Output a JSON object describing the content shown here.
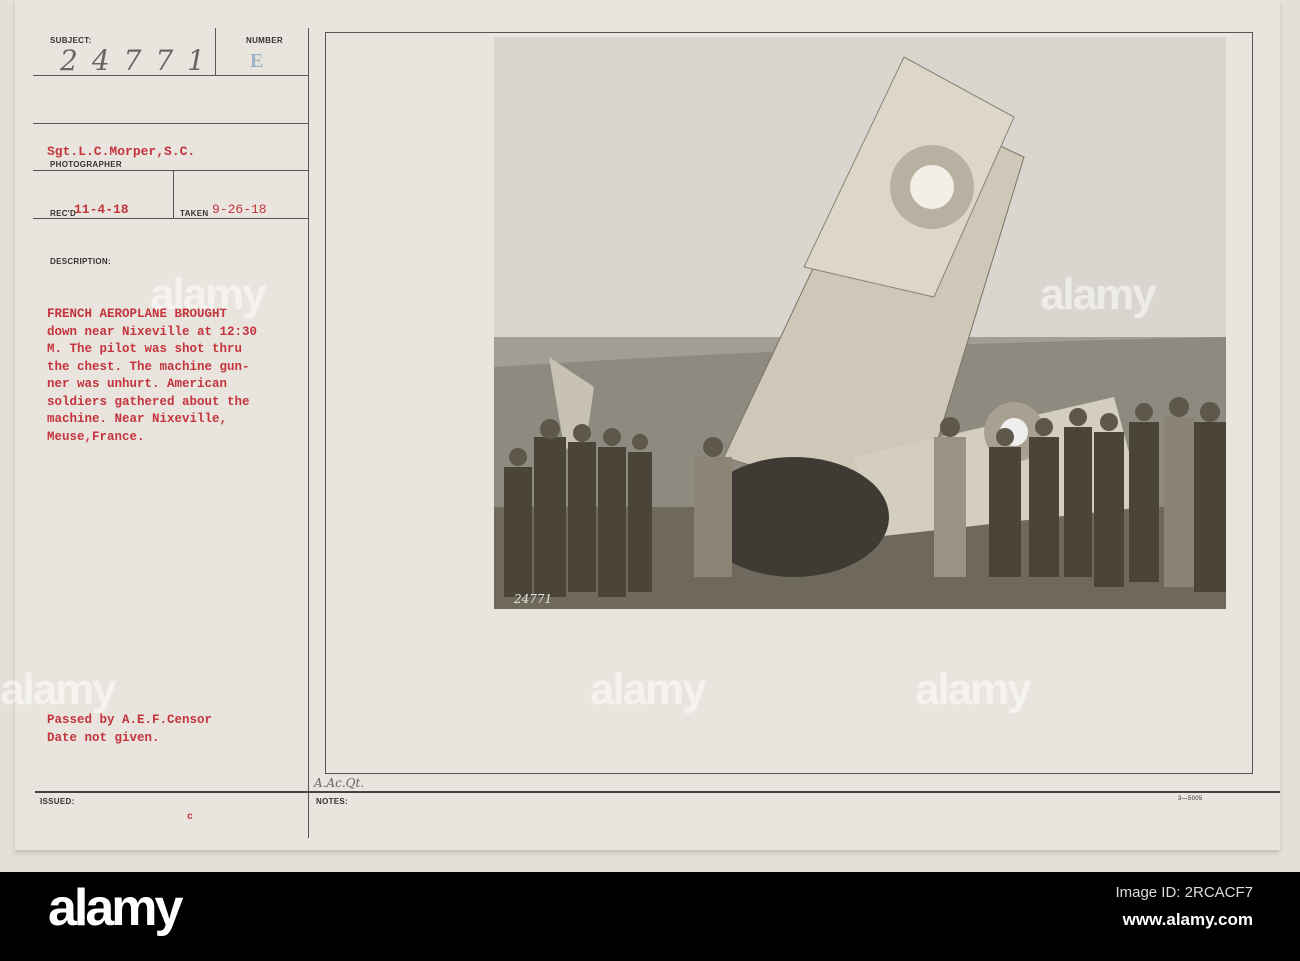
{
  "card": {
    "subject_label": "SUBJECT:",
    "subject_value": "24771",
    "number_label": "NUMBER",
    "number_value": "E",
    "photographer": "Sgt.L.C.Morper,S.C.",
    "photographer_label": "PHOTOGRAPHER",
    "recd_label": "REC'D",
    "recd_value": "11-4-18",
    "taken_label": "TAKEN",
    "taken_value": "9-26-18",
    "description_label": "DESCRIPTION:",
    "description": "FRENCH AEROPLANE BROUGHT\ndown near Nixeville at 12:30\nM.   The pilot was shot thru\nthe chest.  The machine gun-\nner was unhurt.  American\nsoldiers gathered about the\nmachine. Near Nixeville,\nMeuse,France.",
    "censor": "Passed by A.E.F.Censor\nDate not given.",
    "handwritten_note": "A.Ac.Qt.",
    "issued_label": "ISSUED:",
    "issued_mark": "c",
    "notes_label": "NOTES:",
    "form_number": "3—5005",
    "photo_number": "24771"
  },
  "watermark": {
    "brand": "alamy",
    "image_id": "Image ID: 2RCACF7",
    "url": "www.alamy.com"
  }
}
